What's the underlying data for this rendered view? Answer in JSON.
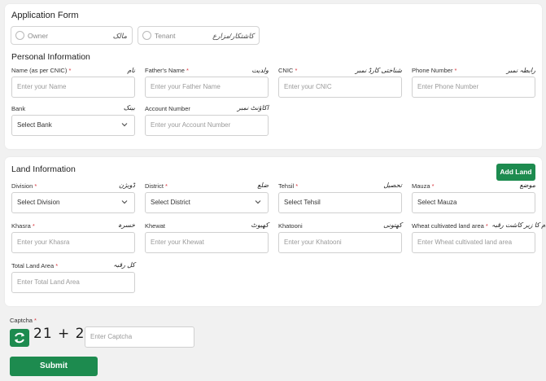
{
  "form_title": "Application Form",
  "radio": [
    {
      "label": "Owner",
      "urdu": "مالک"
    },
    {
      "label": "Tenant",
      "urdu": "کاشتکار/مزارع"
    }
  ],
  "personal": {
    "title": "Personal Information",
    "fields": [
      {
        "label": "Name (as per CNIC)",
        "urdu": "نام",
        "placeholder": "Enter your  Name"
      },
      {
        "label": "Father's Name",
        "urdu": "ولدیت",
        "placeholder": "Enter your Father Name"
      },
      {
        "label": "CNIC",
        "urdu": "شناختی کارڈ نمبر",
        "placeholder": "Enter your CNIC"
      },
      {
        "label": "Phone Number",
        "urdu": "رابطہ نمبر",
        "placeholder": "Enter Phone Number"
      },
      {
        "label": "Bank",
        "urdu": "بینک",
        "value": "Select Bank"
      },
      {
        "label": "Account Number",
        "urdu": "اکاؤنٹ نمبر",
        "placeholder": "Enter your Account Number"
      }
    ]
  },
  "land": {
    "title": "Land Information",
    "add_button": "Add Land",
    "fields": [
      {
        "label": "Division",
        "urdu": "ڈویژن",
        "value": "Select Division"
      },
      {
        "label": "District",
        "urdu": "ضلع",
        "value": "Select District"
      },
      {
        "label": "Tehsil",
        "urdu": "تحصیل",
        "value": "Select Tehsil"
      },
      {
        "label": "Mauza",
        "urdu": "موضع",
        "value": "Select Mauza"
      },
      {
        "label": "Khasra",
        "urdu": "خسرہ",
        "placeholder": "Enter your Khasra"
      },
      {
        "label": "Khewat",
        "urdu": "کھیوٹ",
        "placeholder": "Enter your Khewat"
      },
      {
        "label": "Khatooni",
        "urdu": "کھتونی",
        "placeholder": "Enter your Khatooni"
      },
      {
        "label": "Wheat cultivated land area",
        "urdu": "گندم کا زیر کاشت رقبہ",
        "placeholder": "Enter Wheat cultivated land area"
      },
      {
        "label": "Total Land Area",
        "urdu": "کل رقبہ",
        "placeholder": "Enter Total Land Area"
      }
    ]
  },
  "captcha": {
    "label": "Captcha",
    "challenge": "21 + 2 =",
    "placeholder": "Enter Captcha"
  },
  "submit_label": "Submit",
  "required_mark": "*",
  "colors": {
    "accent": "#1d8b4f",
    "required": "#d9363e"
  }
}
